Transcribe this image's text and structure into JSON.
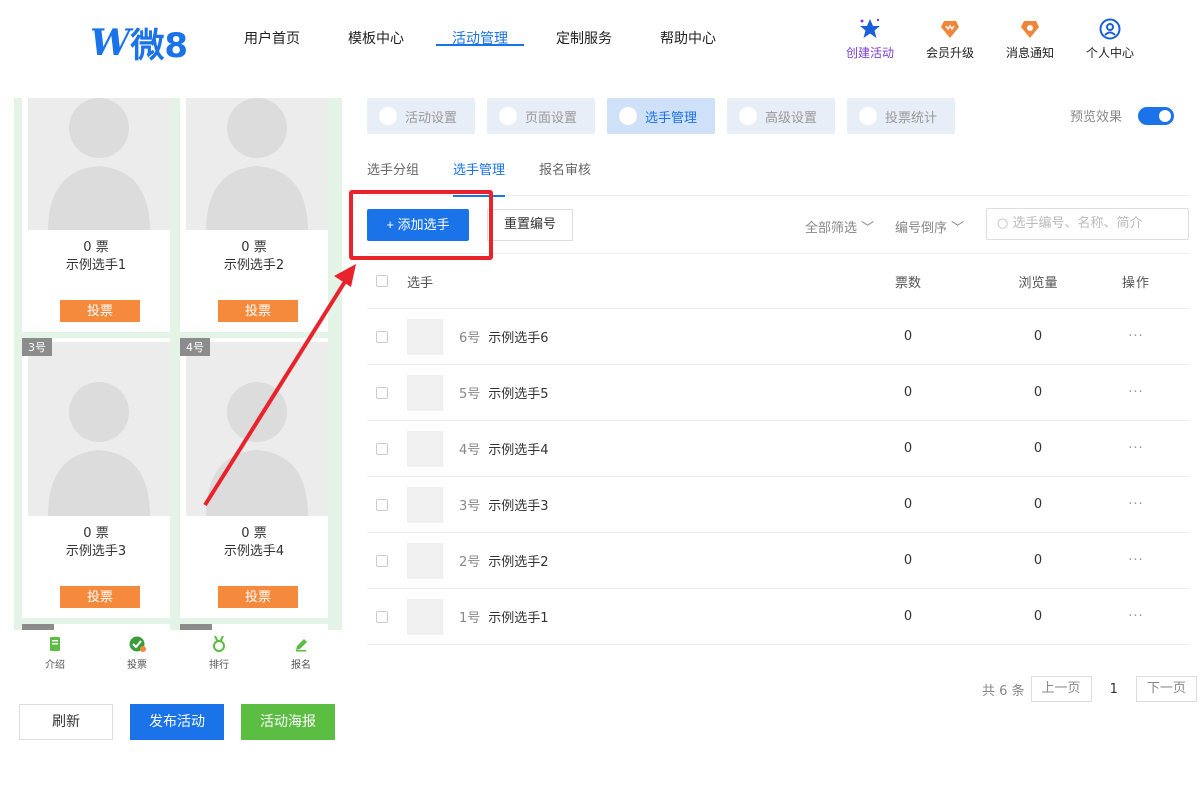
{
  "brand": {
    "logo_letter": "W",
    "logo_text": "微8"
  },
  "nav": [
    {
      "label": "用户首页",
      "active": false
    },
    {
      "label": "模板中心",
      "active": false
    },
    {
      "label": "活动管理",
      "active": true
    },
    {
      "label": "定制服务",
      "active": false
    },
    {
      "label": "帮助中心",
      "active": false
    }
  ],
  "header_actions": [
    {
      "label": "创建活动",
      "icon": "star-icon"
    },
    {
      "label": "会员升级",
      "icon": "vip-badge-icon"
    },
    {
      "label": "消息通知",
      "icon": "bell-badge-icon"
    },
    {
      "label": "个人中心",
      "icon": "user-circle-icon"
    }
  ],
  "preview": {
    "cards": [
      {
        "votes": "0 票",
        "name": "示例选手1",
        "badge": "",
        "vote_label": "投票"
      },
      {
        "votes": "0 票",
        "name": "示例选手2",
        "badge": "",
        "vote_label": "投票"
      },
      {
        "votes": "0 票",
        "name": "示例选手3",
        "badge": "3号",
        "vote_label": "投票"
      },
      {
        "votes": "0 票",
        "name": "示例选手4",
        "badge": "4号",
        "vote_label": "投票"
      }
    ],
    "tabs": [
      {
        "label": "介绍",
        "icon": "bookmark-icon"
      },
      {
        "label": "投票",
        "icon": "vote-icon"
      },
      {
        "label": "排行",
        "icon": "medal-icon"
      },
      {
        "label": "报名",
        "icon": "edit-icon"
      }
    ],
    "buttons": {
      "refresh": "刷新",
      "publish": "发布活动",
      "poster": "活动海报"
    }
  },
  "steps": [
    {
      "label": "活动设置",
      "active": false
    },
    {
      "label": "页面设置",
      "active": false
    },
    {
      "label": "选手管理",
      "active": true
    },
    {
      "label": "高级设置",
      "active": false
    },
    {
      "label": "投票统计",
      "active": false
    }
  ],
  "preview_toggle": {
    "label": "预览效果",
    "on": true
  },
  "subtabs": [
    {
      "label": "选手分组",
      "active": false
    },
    {
      "label": "选手管理",
      "active": true
    },
    {
      "label": "报名审核",
      "active": false
    }
  ],
  "toolbar": {
    "add_label": "+ 添加选手",
    "renumber_label": "重置编号",
    "filter_all": "全部筛选 ﹀",
    "sort_label": "编号倒序 ﹀",
    "search_placeholder": "选手编号、名称、简介"
  },
  "table": {
    "headers": {
      "player": "选手",
      "votes": "票数",
      "views": "浏览量",
      "ops": "操作"
    },
    "rows": [
      {
        "num": "6号",
        "name": "示例选手6",
        "votes": "0",
        "views": "0",
        "ops": "···"
      },
      {
        "num": "5号",
        "name": "示例选手5",
        "votes": "0",
        "views": "0",
        "ops": "···"
      },
      {
        "num": "4号",
        "name": "示例选手4",
        "votes": "0",
        "views": "0",
        "ops": "···"
      },
      {
        "num": "3号",
        "name": "示例选手3",
        "votes": "0",
        "views": "0",
        "ops": "···"
      },
      {
        "num": "2号",
        "name": "示例选手2",
        "votes": "0",
        "views": "0",
        "ops": "···"
      },
      {
        "num": "1号",
        "name": "示例选手1",
        "votes": "0",
        "views": "0",
        "ops": "···"
      }
    ]
  },
  "pager": {
    "total": "共 6 条",
    "prev": "上一页",
    "current": "1",
    "next": "下一页"
  },
  "colors": {
    "accent": "#1a73e8",
    "orange": "#f5893c",
    "green": "#5cbd43",
    "red": "#e8232b"
  }
}
